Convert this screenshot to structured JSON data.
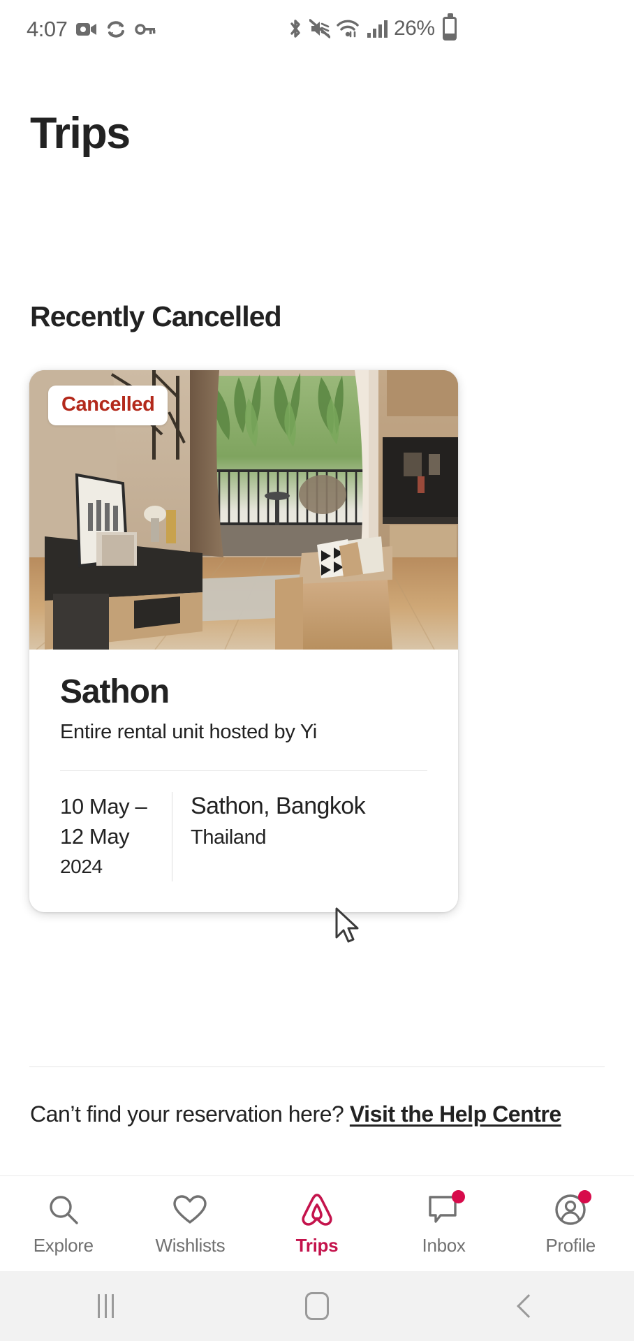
{
  "status_bar": {
    "time": "4:07",
    "battery_percent": "26%",
    "left_icons": [
      "video-camera-icon",
      "sync-icon",
      "vpn-key-icon"
    ],
    "right_icons": [
      "bluetooth-icon",
      "mute-icon",
      "wifi-icon",
      "cellular-signal-icon",
      "battery-icon"
    ]
  },
  "header": {
    "title": "Trips"
  },
  "section": {
    "title": "Recently Cancelled"
  },
  "trip": {
    "badge": "Cancelled",
    "badge_color": "#b3291b",
    "name": "Sathon",
    "subtitle": "Entire rental unit hosted by Yi",
    "date_line_1": "10 May –",
    "date_line_2": "12 May",
    "year": "2024",
    "location_city": "Sathon, Bangkok",
    "location_country": "Thailand",
    "photo_alt": "living-room-with-balcony-photo"
  },
  "help": {
    "question": "Can’t find your reservation here? ",
    "link": "Visit the Help Centre"
  },
  "bottom_nav": {
    "active_color": "#c4134c",
    "inactive_color": "#717171",
    "items": [
      {
        "label": "Explore",
        "icon": "search-icon",
        "active": false,
        "badge": false
      },
      {
        "label": "Wishlists",
        "icon": "heart-icon",
        "active": false,
        "badge": false
      },
      {
        "label": "Trips",
        "icon": "airbnb-belo-icon",
        "active": true,
        "badge": false
      },
      {
        "label": "Inbox",
        "icon": "chat-bubble-icon",
        "active": false,
        "badge": true
      },
      {
        "label": "Profile",
        "icon": "account-circle-icon",
        "active": false,
        "badge": true
      }
    ]
  },
  "android_nav": {
    "recents_label": "recents-button",
    "home_label": "home-button",
    "back_label": "back-button"
  }
}
